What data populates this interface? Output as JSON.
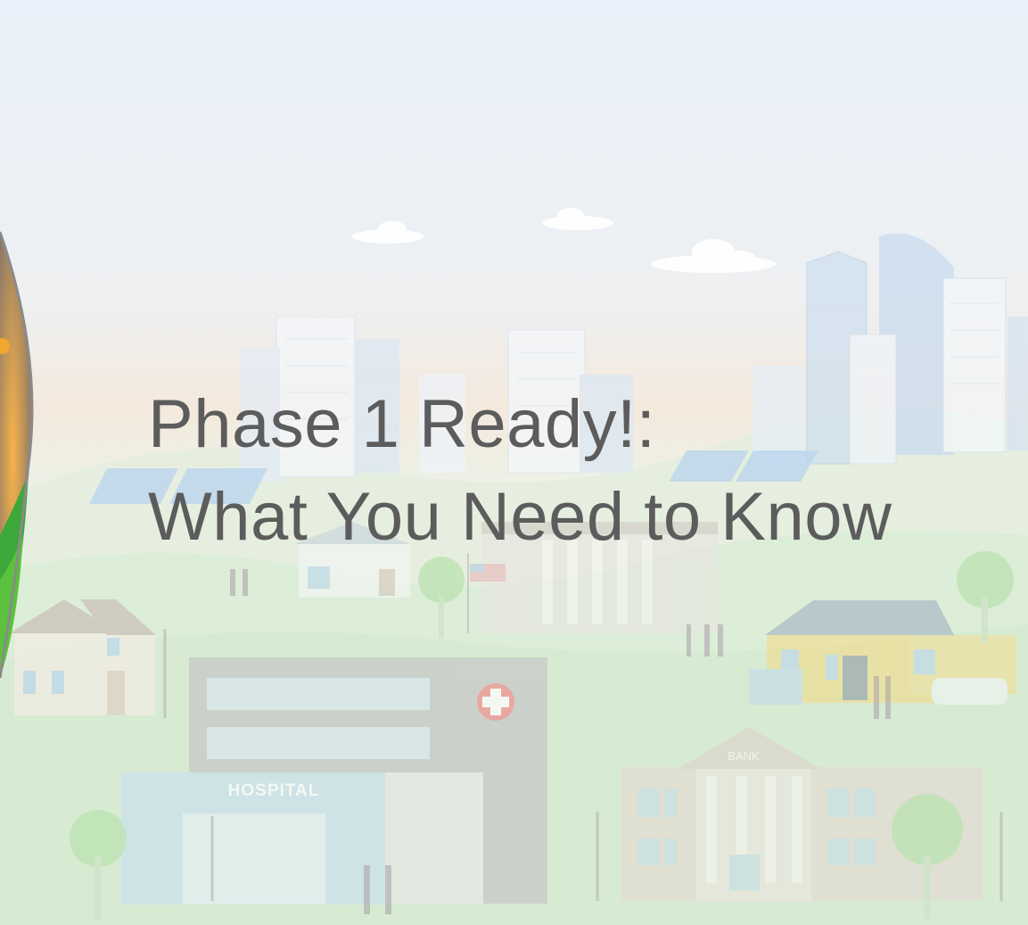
{
  "slide": {
    "title_line_1": "Phase 1 Ready!:",
    "title_line_2": "What You Need to Know"
  },
  "illustration": {
    "hospital_sign": "HOSPITAL",
    "bank_sign": "BANK"
  },
  "colors": {
    "title_text": "#5c5c5c",
    "sky_top": "#e8f0f8",
    "sky_horizon": "#f3e8dc",
    "grass": "#dfeedd",
    "left_arc": "#8a8a8a"
  }
}
